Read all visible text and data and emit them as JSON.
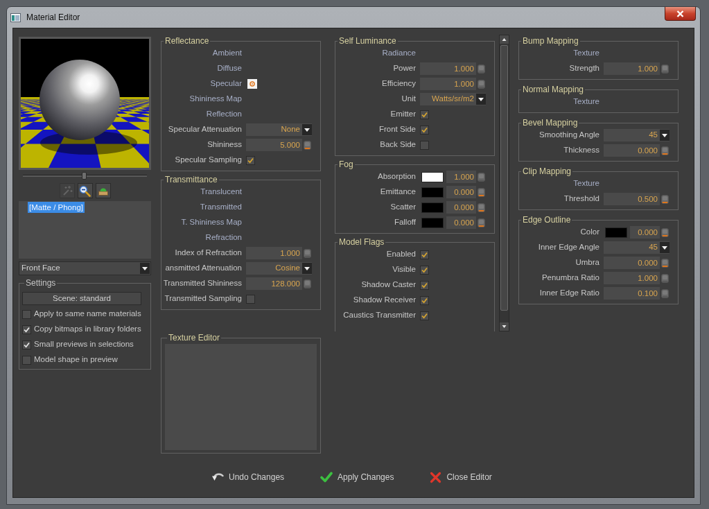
{
  "window": {
    "title": "Material Editor"
  },
  "preview_slider": {
    "level": 0.49
  },
  "preview_tools": [
    {
      "disabled": true
    },
    {
      "disabled": false
    },
    {
      "disabled": false
    }
  ],
  "material_list": [
    {
      "label": "[Matte / Phong]",
      "selected": true
    }
  ],
  "face_dropdown": {
    "value": "Front Face"
  },
  "settings": {
    "title": "Settings",
    "scene_button": "Scene: standard",
    "options": [
      {
        "label": "Apply to same name materials",
        "checked": false
      },
      {
        "label": "Copy bitmaps in library folders",
        "checked": true
      },
      {
        "label": "Small previews in selections",
        "checked": true
      },
      {
        "label": "Model shape in preview",
        "checked": false
      }
    ]
  },
  "columns": [
    {
      "groups": [
        {
          "kind": "fields",
          "title": "Reflectance",
          "rows": [
            {
              "kind": "slot",
              "label": "Ambient"
            },
            {
              "kind": "slot",
              "label": "Diffuse"
            },
            {
              "kind": "map",
              "label": "Specular"
            },
            {
              "kind": "slot",
              "label": "Shininess Map"
            },
            {
              "kind": "slot",
              "label": "Reflection"
            },
            {
              "kind": "select",
              "label": "Specular Attenuation",
              "value": "None"
            },
            {
              "kind": "number",
              "label": "Shininess",
              "value": "5.000",
              "knob_lit": true
            },
            {
              "kind": "checkbox",
              "label": "Specular Sampling",
              "checked": true
            }
          ]
        },
        {
          "kind": "fields",
          "title": "Transmittance",
          "rows": [
            {
              "kind": "slot",
              "label": "Translucent"
            },
            {
              "kind": "slot",
              "label": "Transmitted"
            },
            {
              "kind": "slot",
              "label": "T. Shininess Map"
            },
            {
              "kind": "slot",
              "label": "Refraction"
            },
            {
              "kind": "number",
              "label": "Index of Refraction",
              "value": "1.000",
              "knob_lit": false
            },
            {
              "kind": "select",
              "label": "ansmitted Attenuation",
              "value": "Cosine"
            },
            {
              "kind": "number",
              "label": "Transmitted Shininess",
              "value": "128.000",
              "knob_lit": false
            },
            {
              "kind": "checkbox",
              "label": "Transmitted Sampling",
              "checked": false
            }
          ]
        },
        {
          "kind": "canvas",
          "title": "Texture Editor"
        }
      ]
    },
    {
      "scrollable": true,
      "groups": [
        {
          "kind": "fields",
          "title": "Self Luminance",
          "rows": [
            {
              "kind": "slot",
              "label": "Radiance"
            },
            {
              "kind": "number",
              "label": "Power",
              "value": "1.000",
              "knob_lit": false
            },
            {
              "kind": "number",
              "label": "Efficiency",
              "value": "1.000",
              "knob_lit": false
            },
            {
              "kind": "select",
              "label": "Unit",
              "value": "Watts/sr/m2"
            },
            {
              "kind": "checkbox",
              "label": "Emitter",
              "checked": true
            },
            {
              "kind": "checkbox",
              "label": "Front Side",
              "checked": true
            },
            {
              "kind": "checkbox",
              "label": "Back Side",
              "checked": false
            }
          ]
        },
        {
          "kind": "fields",
          "title": "Fog",
          "rows": [
            {
              "kind": "color",
              "label": "Absorption",
              "color": "#ffffff",
              "value": "1.000",
              "knob_lit": false
            },
            {
              "kind": "color",
              "label": "Emittance",
              "color": "#000000",
              "value": "0.000",
              "knob_lit": true
            },
            {
              "kind": "color",
              "label": "Scatter",
              "color": "#000000",
              "value": "0.000",
              "knob_lit": true
            },
            {
              "kind": "color",
              "label": "Falloff",
              "color": "#000000",
              "value": "0.000",
              "knob_lit": true
            }
          ]
        },
        {
          "kind": "fields",
          "title": "Model Flags",
          "rows": [
            {
              "kind": "checkbox",
              "label": "Enabled",
              "checked": true
            },
            {
              "kind": "checkbox",
              "label": "Visible",
              "checked": true
            },
            {
              "kind": "checkbox",
              "label": "Shadow Caster",
              "checked": true
            },
            {
              "kind": "checkbox",
              "label": "Shadow Receiver",
              "checked": true
            },
            {
              "kind": "checkbox",
              "label": "Caustics Transmitter",
              "checked": true
            }
          ]
        }
      ]
    },
    {
      "groups": [
        {
          "kind": "fields",
          "title": "Bump Mapping",
          "rows": [
            {
              "kind": "slot",
              "label": "Texture"
            },
            {
              "kind": "number",
              "label": "Strength",
              "value": "1.000",
              "knob_lit": false
            }
          ]
        },
        {
          "kind": "fields",
          "title": "Normal Mapping",
          "rows": [
            {
              "kind": "slot",
              "label": "Texture"
            }
          ]
        },
        {
          "kind": "fields",
          "title": "Bevel Mapping",
          "rows": [
            {
              "kind": "select",
              "label": "Smoothing Angle",
              "value": "45"
            },
            {
              "kind": "number",
              "label": "Thickness",
              "value": "0.000",
              "knob_lit": true
            }
          ]
        },
        {
          "kind": "fields",
          "title": "Clip Mapping",
          "rows": [
            {
              "kind": "slot",
              "label": "Texture"
            },
            {
              "kind": "number",
              "label": "Threshold",
              "value": "0.500",
              "knob_lit": true
            }
          ]
        },
        {
          "kind": "fields",
          "title": "Edge Outline",
          "rows": [
            {
              "kind": "color",
              "label": "Color",
              "color": "#000000",
              "value": "0.000",
              "knob_lit": true
            },
            {
              "kind": "select",
              "label": "Inner Edge Angle",
              "value": "45"
            },
            {
              "kind": "number",
              "label": "Umbra",
              "value": "0.000",
              "knob_lit": true
            },
            {
              "kind": "number",
              "label": "Penumbra Ratio",
              "value": "1.000",
              "knob_lit": false
            },
            {
              "kind": "number",
              "label": "Inner Edge Ratio",
              "value": "0.100",
              "knob_lit": false
            }
          ]
        }
      ]
    }
  ],
  "actions": [
    {
      "label": "Undo Changes"
    },
    {
      "label": "Apply Changes"
    },
    {
      "label": "Close Editor"
    }
  ]
}
